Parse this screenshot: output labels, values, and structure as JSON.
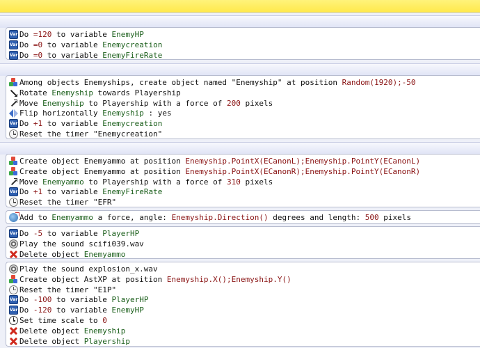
{
  "blocks": [
    {
      "actions": [
        {
          "icon": "variable-icon",
          "parts": [
            {
              "t": "Do ",
              "c": "kw"
            },
            {
              "t": "=120",
              "c": "val"
            },
            {
              "t": " to variable ",
              "c": "kw"
            },
            {
              "t": "EnemyHP",
              "c": "hl"
            }
          ]
        },
        {
          "icon": "variable-icon",
          "parts": [
            {
              "t": "Do ",
              "c": "kw"
            },
            {
              "t": "=0",
              "c": "val"
            },
            {
              "t": " to variable ",
              "c": "kw"
            },
            {
              "t": "Enemycreation",
              "c": "hl"
            }
          ]
        },
        {
          "icon": "variable-icon",
          "parts": [
            {
              "t": "Do ",
              "c": "kw"
            },
            {
              "t": "=0",
              "c": "val"
            },
            {
              "t": " to variable ",
              "c": "kw"
            },
            {
              "t": "EnemyFireRate",
              "c": "hl"
            }
          ]
        }
      ]
    },
    {
      "actions": [
        {
          "icon": "objects-icon",
          "parts": [
            {
              "t": "Among objects Enemyships, create object named \"Enemyship\" at position ",
              "c": "kw"
            },
            {
              "t": "Random(1920);-50",
              "c": "val"
            }
          ]
        },
        {
          "icon": "rotate-icon",
          "parts": [
            {
              "t": "Rotate ",
              "c": "kw"
            },
            {
              "t": "Enemyship",
              "c": "obj"
            },
            {
              "t": " towards Playership",
              "c": "kw"
            }
          ]
        },
        {
          "icon": "move-icon",
          "parts": [
            {
              "t": "Move ",
              "c": "kw"
            },
            {
              "t": "Enemyship",
              "c": "obj"
            },
            {
              "t": " to Playership with a force of ",
              "c": "kw"
            },
            {
              "t": "200",
              "c": "val"
            },
            {
              "t": " pixels",
              "c": "kw"
            }
          ]
        },
        {
          "icon": "flip-icon",
          "parts": [
            {
              "t": "Flip horizontally ",
              "c": "kw"
            },
            {
              "t": "Enemyship",
              "c": "obj"
            },
            {
              "t": " : yes",
              "c": "kw"
            }
          ]
        },
        {
          "icon": "variable-icon",
          "parts": [
            {
              "t": "Do ",
              "c": "kw"
            },
            {
              "t": "+1",
              "c": "val"
            },
            {
              "t": " to variable ",
              "c": "kw"
            },
            {
              "t": "Enemycreation",
              "c": "hl"
            }
          ]
        },
        {
          "icon": "timer-icon",
          "parts": [
            {
              "t": "Reset the timer \"Enemycreation\"",
              "c": "kw"
            }
          ]
        }
      ]
    },
    {
      "actions": [
        {
          "icon": "objects-icon",
          "parts": [
            {
              "t": "Create object Enemyammo at position ",
              "c": "kw"
            },
            {
              "t": "Enemyship.PointX(ECanonL);Enemyship.PointY(ECanonL)",
              "c": "val"
            }
          ]
        },
        {
          "icon": "objects-icon",
          "parts": [
            {
              "t": "Create object Enemyammo at position ",
              "c": "kw"
            },
            {
              "t": "Enemyship.PointX(ECanonR);Enemyship.PointY(ECanonR)",
              "c": "val"
            }
          ]
        },
        {
          "icon": "move-icon",
          "parts": [
            {
              "t": "Move ",
              "c": "kw"
            },
            {
              "t": "Enemyammo",
              "c": "obj"
            },
            {
              "t": " to Playership with a force of ",
              "c": "kw"
            },
            {
              "t": "310",
              "c": "val"
            },
            {
              "t": " pixels",
              "c": "kw"
            }
          ]
        },
        {
          "icon": "variable-icon",
          "parts": [
            {
              "t": "Do ",
              "c": "kw"
            },
            {
              "t": "+1",
              "c": "val"
            },
            {
              "t": " to variable ",
              "c": "kw"
            },
            {
              "t": "EnemyFireRate",
              "c": "hl"
            }
          ]
        },
        {
          "icon": "timer-icon",
          "parts": [
            {
              "t": "Reset the timer \"EFR\"",
              "c": "kw"
            }
          ]
        }
      ]
    },
    {
      "actions": [
        {
          "icon": "force-icon",
          "parts": [
            {
              "t": "Add to ",
              "c": "kw"
            },
            {
              "t": "Enemyammo",
              "c": "obj"
            },
            {
              "t": " a force, angle: ",
              "c": "kw"
            },
            {
              "t": "Enemyship.Direction()",
              "c": "val"
            },
            {
              "t": " degrees and length: ",
              "c": "kw"
            },
            {
              "t": "500",
              "c": "val"
            },
            {
              "t": " pixels",
              "c": "kw"
            }
          ]
        }
      ]
    },
    {
      "actions": [
        {
          "icon": "variable-icon",
          "parts": [
            {
              "t": "Do ",
              "c": "kw"
            },
            {
              "t": "-5",
              "c": "val"
            },
            {
              "t": " to variable ",
              "c": "kw"
            },
            {
              "t": "PlayerHP",
              "c": "hl"
            }
          ]
        },
        {
          "icon": "sound-icon",
          "parts": [
            {
              "t": "Play the sound scifi039.wav",
              "c": "kw"
            }
          ]
        },
        {
          "icon": "delete-icon",
          "parts": [
            {
              "t": "Delete object ",
              "c": "kw"
            },
            {
              "t": "Enemyammo",
              "c": "obj"
            }
          ]
        }
      ]
    },
    {
      "actions": [
        {
          "icon": "sound-icon",
          "parts": [
            {
              "t": "Play the sound explosion_x.wav",
              "c": "kw"
            }
          ]
        },
        {
          "icon": "objects-icon",
          "parts": [
            {
              "t": "Create object AstXP at position ",
              "c": "kw"
            },
            {
              "t": "Enemyship.X();Enemyship.Y()",
              "c": "val"
            }
          ]
        },
        {
          "icon": "timer-icon",
          "parts": [
            {
              "t": "Reset the timer \"E1P\"",
              "c": "kw"
            }
          ]
        },
        {
          "icon": "variable-icon",
          "parts": [
            {
              "t": "Do ",
              "c": "kw"
            },
            {
              "t": "-100",
              "c": "val"
            },
            {
              "t": " to variable ",
              "c": "kw"
            },
            {
              "t": "PlayerHP",
              "c": "hl"
            }
          ]
        },
        {
          "icon": "variable-icon",
          "parts": [
            {
              "t": "Do ",
              "c": "kw"
            },
            {
              "t": "-120",
              "c": "val"
            },
            {
              "t": " to variable ",
              "c": "kw"
            },
            {
              "t": "EnemyHP",
              "c": "hl"
            }
          ]
        },
        {
          "icon": "clock-icon",
          "parts": [
            {
              "t": "Set time scale to ",
              "c": "kw"
            },
            {
              "t": "0",
              "c": "val"
            }
          ]
        },
        {
          "icon": "delete-icon",
          "parts": [
            {
              "t": "Delete object ",
              "c": "kw"
            },
            {
              "t": "Enemyship",
              "c": "obj"
            }
          ]
        },
        {
          "icon": "delete-icon",
          "parts": [
            {
              "t": "Delete object ",
              "c": "kw"
            },
            {
              "t": "Playership",
              "c": "obj"
            }
          ]
        }
      ]
    }
  ],
  "icon_glyphs": {
    "variable-icon": "Var"
  }
}
